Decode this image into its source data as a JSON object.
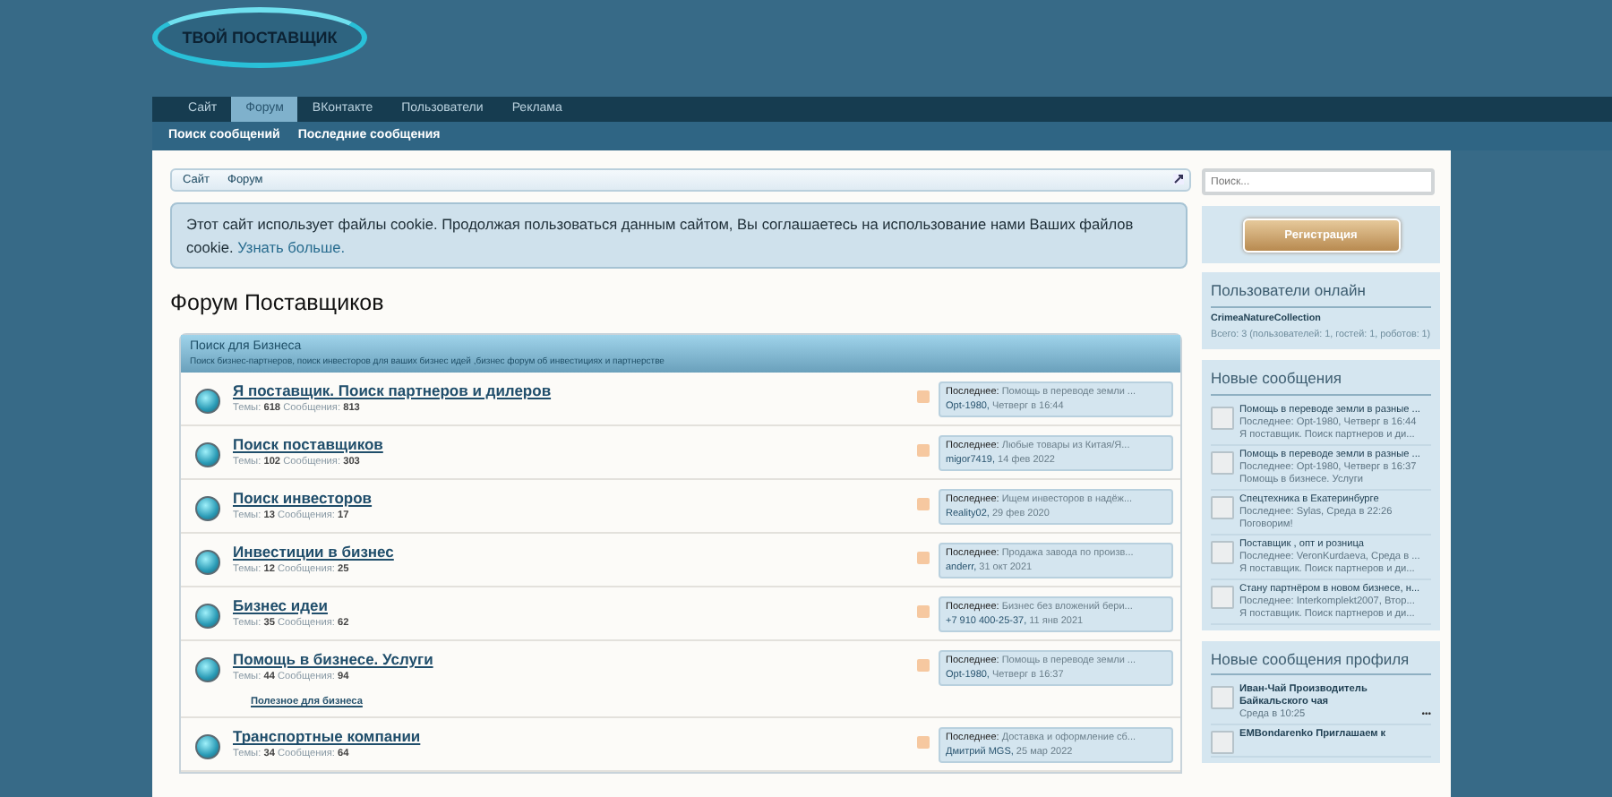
{
  "logo": {
    "text": "ТВОЙ ПОСТАВЩИК"
  },
  "nav_tabs": [
    {
      "label": "Сайт",
      "selected": false
    },
    {
      "label": "Форум",
      "selected": true
    },
    {
      "label": "ВКонтакте",
      "selected": false
    },
    {
      "label": "Пользователи",
      "selected": false
    },
    {
      "label": "Реклама",
      "selected": false
    }
  ],
  "sub_nav": [
    "Поиск сообщений",
    "Последние сообщения"
  ],
  "breadcrumb": [
    "Сайт",
    "Форум"
  ],
  "cookie_notice": {
    "text": "Этот сайт использует файлы cookie. Продолжая пользоваться данным сайтом, Вы соглашаетесь на использование нами Ваших файлов cookie.",
    "link": "Узнать больше."
  },
  "page_title": "Форум Поставщиков",
  "category": {
    "title": "Поиск для Бизнеса",
    "description": "Поиск бизнес-партнеров, поиск инвесторов для ваших бизнес идей ,бизнес форум об инвестициях и партнерстве"
  },
  "forums": [
    {
      "name": "Я поставщик. Поиск партнеров и дилеров",
      "threads_label": "Темы:",
      "threads": "618",
      "messages_label": "Сообщения:",
      "messages": "813",
      "last_label": "Последнее:",
      "last_title": "Помощь в переводе земли ...",
      "last_user": "Opt-1980,",
      "last_date": "Четверг в 16:44"
    },
    {
      "name": "Поиск поставщиков",
      "threads_label": "Темы:",
      "threads": "102",
      "messages_label": "Сообщения:",
      "messages": "303",
      "last_label": "Последнее:",
      "last_title": "Любые товары из Китая/Я...",
      "last_user": "migor7419,",
      "last_date": "14 фев 2022"
    },
    {
      "name": "Поиск инвесторов",
      "threads_label": "Темы:",
      "threads": "13",
      "messages_label": "Сообщения:",
      "messages": "17",
      "last_label": "Последнее:",
      "last_title": "Ищем инвесторов в надёж...",
      "last_user": "Reality02,",
      "last_date": "29 фев 2020"
    },
    {
      "name": "Инвестиции в бизнес",
      "threads_label": "Темы:",
      "threads": "12",
      "messages_label": "Сообщения:",
      "messages": "25",
      "last_label": "Последнее:",
      "last_title": "Продажа завода по произв...",
      "last_user": "anderr,",
      "last_date": "31 окт 2021"
    },
    {
      "name": "Бизнес идеи",
      "threads_label": "Темы:",
      "threads": "35",
      "messages_label": "Сообщения:",
      "messages": "62",
      "last_label": "Последнее:",
      "last_title": "Бизнес без вложений бери...",
      "last_user": "+7 910 400-25-37,",
      "last_date": "11 янв 2021"
    },
    {
      "name": "Помощь в бизнесе. Услуги",
      "threads_label": "Темы:",
      "threads": "44",
      "messages_label": "Сообщения:",
      "messages": "94",
      "last_label": "Последнее:",
      "last_title": "Помощь в переводе земли ...",
      "last_user": "Opt-1980,",
      "last_date": "Четверг в 16:37",
      "subforums": [
        "Полезное для бизнеса"
      ]
    },
    {
      "name": "Транспортные компании",
      "threads_label": "Темы:",
      "threads": "34",
      "messages_label": "Сообщения:",
      "messages": "64",
      "last_label": "Последнее:",
      "last_title": "Доставка и оформление сб...",
      "last_user": "Дмитрий MGS,",
      "last_date": "25 мар 2022"
    }
  ],
  "sidebar": {
    "search_placeholder": "Поиск...",
    "register_button": "Регистрация",
    "online": {
      "title": "Пользователи онлайн",
      "users": "CrimeaNatureCollection",
      "summary": "Всего: 3 (пользователей: 1, гостей: 1, роботов: 1)"
    },
    "new_posts": {
      "title": "Новые сообщения",
      "items": [
        {
          "title": "Помощь в переводе земли в разные ...",
          "meta": "Последнее: Opt-1980, Четверг в 16:44",
          "forum": "Я поставщик. Поиск партнеров и ди..."
        },
        {
          "title": "Помощь в переводе земли в разные ...",
          "meta": "Последнее: Opt-1980, Четверг в 16:37",
          "forum": "Помощь в бизнесе. Услуги"
        },
        {
          "title": "Спецтехника в Екатеринбурге",
          "meta": "Последнее: Sylas, Среда в 22:26",
          "forum": "Поговорим!"
        },
        {
          "title": "Поставщик , опт и розница",
          "meta": "Последнее: VeronKurdaeva, Среда в ...",
          "forum": "Я поставщик. Поиск партнеров и ди..."
        },
        {
          "title": "Стану партнёром в новом бизнесе, н...",
          "meta": "Последнее: Interkomplekt2007, Втор...",
          "forum": "Я поставщик. Поиск партнеров и ди..."
        }
      ]
    },
    "profile_posts": {
      "title": "Новые сообщения профиля",
      "items": [
        {
          "author": "Иван-Чай",
          "text": "Производитель Байкальского чая",
          "date": "Среда в 10:25",
          "more": "•••"
        },
        {
          "author": "EMBondarenko",
          "text": "Приглашаем к"
        }
      ]
    }
  }
}
